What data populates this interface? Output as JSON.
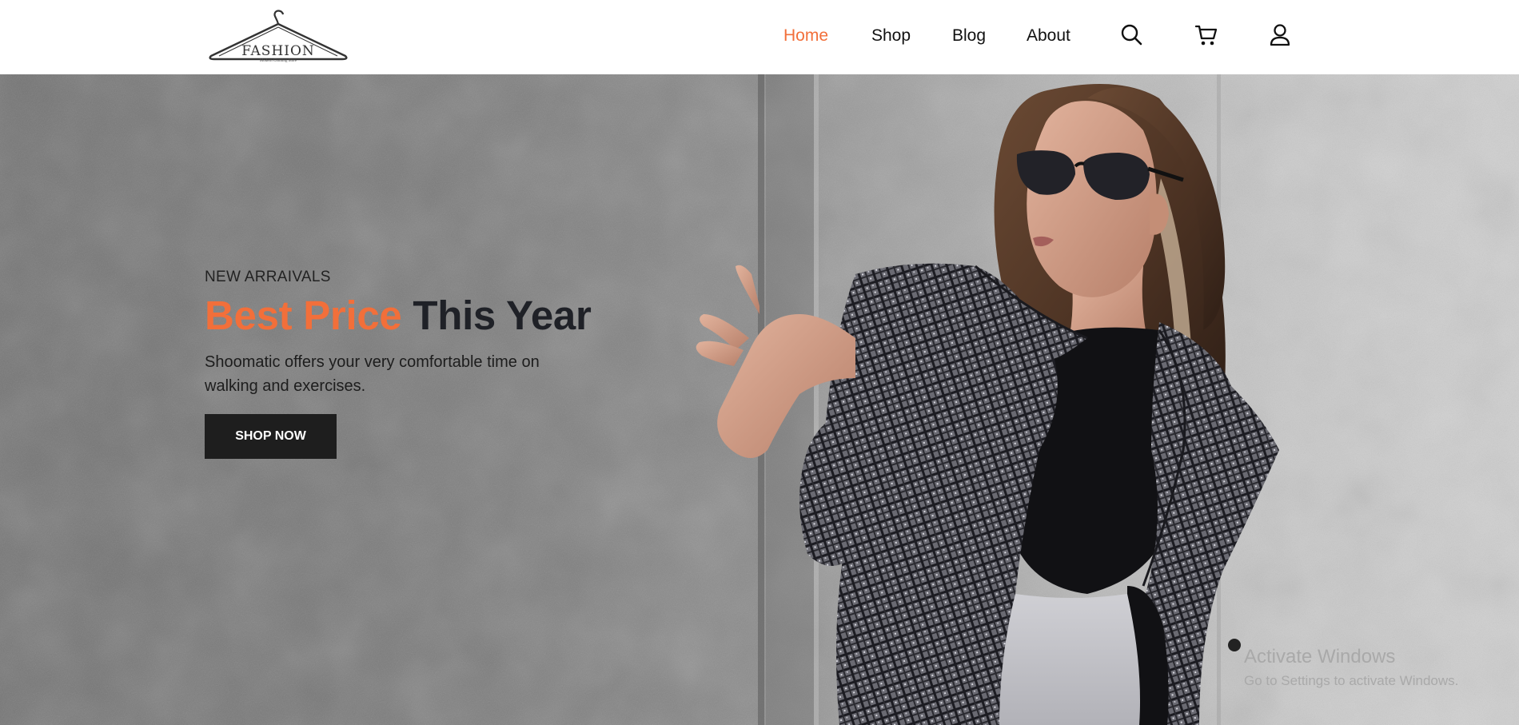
{
  "header": {
    "logo": {
      "text": "FASHION",
      "subtitle": "Modern Clothing Store"
    },
    "nav": [
      {
        "label": "Home",
        "active": true
      },
      {
        "label": "Shop",
        "active": false
      },
      {
        "label": "Blog",
        "active": false
      },
      {
        "label": "About",
        "active": false
      }
    ],
    "icons": [
      "search-icon",
      "cart-icon",
      "user-icon"
    ]
  },
  "hero": {
    "eyebrow": "NEW ARRAIVALS",
    "headline_highlight": "Best Price",
    "headline_rest": "This Year",
    "description": "Shoomatic offers your very comfortable time on walking and exercises.",
    "cta_label": "SHOP NOW"
  },
  "watermark": {
    "title": "Activate Windows",
    "subtitle": "Go to Settings to activate Windows."
  },
  "colors": {
    "accent": "#f26f3a",
    "heading": "#1f2127",
    "button_bg": "#1e1e1e"
  }
}
